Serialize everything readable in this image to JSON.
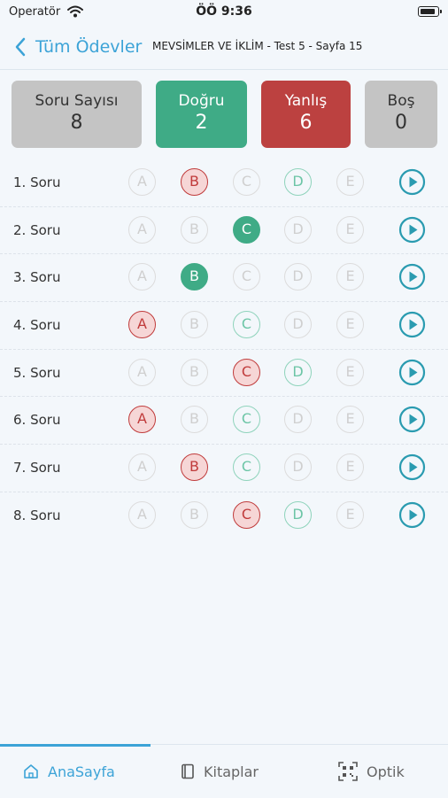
{
  "status": {
    "carrier": "Operatör",
    "time": "ÖÖ 9:36"
  },
  "nav": {
    "back_label": "Tüm Ödevler",
    "title": "MEVSİMLER VE İKLİM - Test 5 - Sayfa 15"
  },
  "summary": {
    "total": {
      "label": "Soru Sayısı",
      "value": "8"
    },
    "correct": {
      "label": "Doğru",
      "value": "2"
    },
    "wrong": {
      "label": "Yanlış",
      "value": "6"
    },
    "empty": {
      "label": "Boş",
      "value": "0"
    }
  },
  "options": [
    "A",
    "B",
    "C",
    "D",
    "E"
  ],
  "questions": [
    {
      "label": "1. Soru",
      "selected": "B",
      "answer": "D"
    },
    {
      "label": "2. Soru",
      "selected": "C",
      "answer": "C"
    },
    {
      "label": "3. Soru",
      "selected": "B",
      "answer": "B"
    },
    {
      "label": "4. Soru",
      "selected": "A",
      "answer": "C"
    },
    {
      "label": "5. Soru",
      "selected": "C",
      "answer": "D"
    },
    {
      "label": "6. Soru",
      "selected": "A",
      "answer": "C"
    },
    {
      "label": "7. Soru",
      "selected": "B",
      "answer": "C"
    },
    {
      "label": "8. Soru",
      "selected": "C",
      "answer": "D"
    }
  ],
  "tabs": [
    {
      "label": "AnaSayfa",
      "icon": "home-icon",
      "active": true
    },
    {
      "label": "Kitaplar",
      "icon": "book-icon",
      "active": false
    },
    {
      "label": "Optik",
      "icon": "qr-scan-icon",
      "active": false
    }
  ],
  "colors": {
    "accent": "#3ca3d7",
    "correct": "#3fab86",
    "wrong": "#bc4140",
    "neutral": "#c4c4c4",
    "play": "#2a9bb0"
  }
}
